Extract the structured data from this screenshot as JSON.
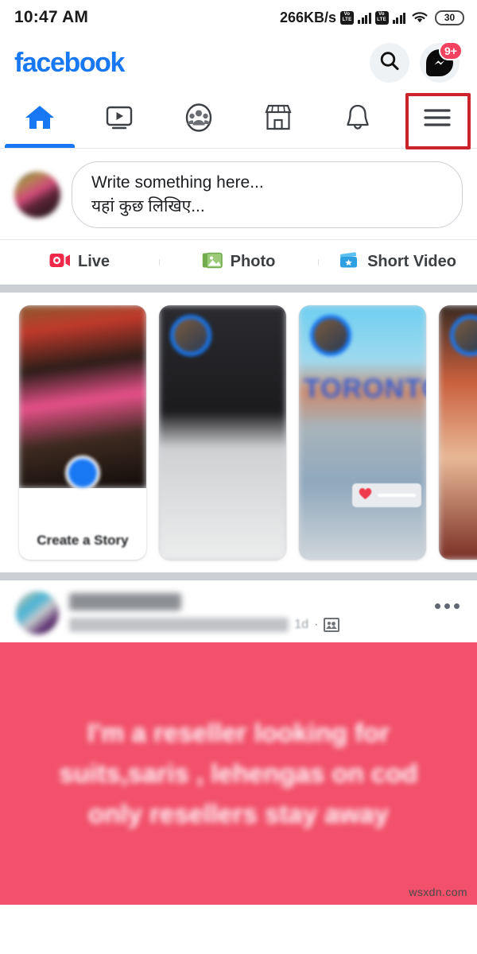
{
  "statusbar": {
    "time": "10:47 AM",
    "network_speed": "266KB/s",
    "volte_label_top": "Vo",
    "volte_label_bottom": "LTE",
    "battery_level": "30",
    "wifi_icon": "wifi-icon",
    "signal_icon": "signal-bars-icon"
  },
  "header": {
    "logo_text": "facebook",
    "logo_color": "#1877f2",
    "search_icon": "search-icon",
    "messenger_icon": "messenger-icon",
    "messenger_badge": "9+",
    "badge_color": "#f3425f"
  },
  "navtabs": {
    "active_index": 0,
    "active_color": "#1877f2",
    "highlight_color": "#cc2229",
    "items": [
      {
        "name": "home",
        "icon": "home-icon",
        "active": true
      },
      {
        "name": "watch",
        "icon": "video-play-icon",
        "active": false
      },
      {
        "name": "groups",
        "icon": "groups-icon",
        "active": false
      },
      {
        "name": "marketplace",
        "icon": "marketplace-store-icon",
        "active": false
      },
      {
        "name": "notifications",
        "icon": "bell-icon",
        "active": false
      },
      {
        "name": "menu",
        "icon": "hamburger-menu-icon",
        "active": false,
        "highlighted": true
      }
    ]
  },
  "composer": {
    "avatar": "user-avatar",
    "placeholder_line1": "Write something here...",
    "placeholder_line2": "यहां कुछ लिखिए..."
  },
  "actions": [
    {
      "label": "Live",
      "icon": "live-video-icon",
      "color": "#f02849"
    },
    {
      "label": "Photo",
      "icon": "photo-icon",
      "color": "#6dab4a"
    },
    {
      "label": "Short Video",
      "icon": "short-video-clapper-icon",
      "color": "#2e9fe0"
    }
  ],
  "stories": {
    "create_label": "Create a Story",
    "create_plus_icon": "plus-icon",
    "items": [
      {
        "type": "create",
        "label": "Create a Story"
      },
      {
        "type": "story",
        "label": ""
      },
      {
        "type": "story",
        "label": "",
        "overlay": "TORONTO",
        "heart_icon": "heart-icon"
      },
      {
        "type": "story",
        "label": ""
      }
    ]
  },
  "post": {
    "author": "",
    "shared_by": "",
    "timestamp": "1d",
    "separator": "·",
    "privacy_icon": "photo-privacy-icon",
    "menu_icon": "more-options-icon",
    "background_color": "#f2506b",
    "text": "I'm a reseller looking for suits,saris , lehengas on cod only resellers stay away",
    "watermark": "wsxdn.com"
  }
}
